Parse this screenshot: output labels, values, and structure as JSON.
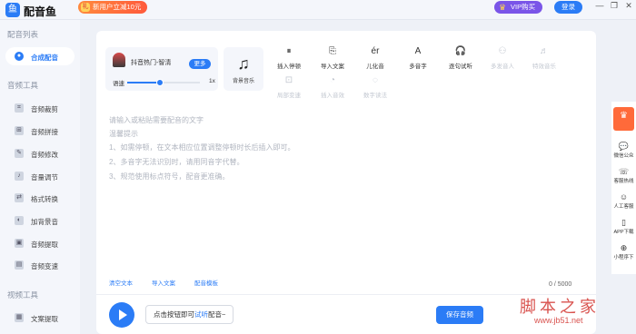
{
  "app": {
    "name": "配音鱼",
    "logo_glyph": "鱼"
  },
  "topbar": {
    "promo": "新用户立减10元",
    "gift_glyph": "礼",
    "vip": "VIP购买",
    "login": "登录",
    "controls": [
      "—",
      "❐",
      "✕"
    ]
  },
  "sidebar": {
    "sections": [
      {
        "title": "配音列表",
        "items": [
          {
            "label": "合成配音",
            "icon": "mic-icon",
            "glyph": "●",
            "active": true
          }
        ]
      },
      {
        "title": "音频工具",
        "items": [
          {
            "label": "音频裁剪",
            "icon": "crop-icon",
            "glyph": "⌗"
          },
          {
            "label": "音频拼接",
            "icon": "merge-icon",
            "glyph": "⊞"
          },
          {
            "label": "音频修改",
            "icon": "edit-icon",
            "glyph": "✎"
          },
          {
            "label": "音量调节",
            "icon": "volume-icon",
            "glyph": "♪"
          },
          {
            "label": "格式转换",
            "icon": "convert-icon",
            "glyph": "⇄"
          },
          {
            "label": "加背景音",
            "icon": "add-bg-icon",
            "glyph": "◐"
          },
          {
            "label": "音频提取",
            "icon": "extract-icon",
            "glyph": "▣"
          },
          {
            "label": "音频变速",
            "icon": "speed-icon",
            "glyph": "▤"
          }
        ]
      },
      {
        "title": "视频工具",
        "items": [
          {
            "label": "文案提取",
            "icon": "text-extract-icon",
            "glyph": "▦"
          }
        ]
      }
    ]
  },
  "voice": {
    "name": "抖音热门-智清",
    "more": "更多",
    "speed_label": "语速",
    "speed_value": "1x",
    "speed_fraction": 0.45
  },
  "bgmusic": {
    "label": "背景音乐",
    "glyph": "♫"
  },
  "tools": [
    {
      "label": "插入停顿",
      "icon": "pause-icon",
      "glyph": "⏸",
      "enabled": true
    },
    {
      "label": "导入文案",
      "icon": "import-text-icon",
      "glyph": "⎘",
      "enabled": true
    },
    {
      "label": "儿化音",
      "icon": "erhua-icon",
      "glyph": "ér",
      "enabled": true
    },
    {
      "label": "多音字",
      "icon": "polyphone-icon",
      "glyph": "A",
      "enabled": true
    },
    {
      "label": "逐句试听",
      "icon": "headphone-icon",
      "glyph": "🎧",
      "enabled": true
    },
    {
      "label": "多发音人",
      "icon": "multi-speaker-icon",
      "glyph": "⚇",
      "enabled": false
    },
    {
      "label": "特效音乐",
      "icon": "effect-music-icon",
      "glyph": "♬",
      "enabled": false
    },
    {
      "label": "局部变速",
      "icon": "local-speed-icon",
      "glyph": "⊡",
      "enabled": false
    },
    {
      "label": "插入音效",
      "icon": "sound-effect-icon",
      "glyph": "◔",
      "enabled": false
    },
    {
      "label": "数字读法",
      "icon": "number-read-icon",
      "glyph": "◌",
      "enabled": false
    }
  ],
  "editor": {
    "placeholder": "请输入或粘贴需要配音的文字",
    "tip_title": "温馨提示",
    "tips": [
      "1、如需停顿，在文本相应位置调整停顿时长后插入即可。",
      "2、多音字无法识别时，请用同音字代替。",
      "3、规范使用标点符号，配音更准确。"
    ],
    "counter": "0 / 5000"
  },
  "quick_actions": [
    "清空文本",
    "导入文案",
    "配音模板"
  ],
  "bottom": {
    "hint_prefix": "点击按钮即可",
    "hint_link": "试听",
    "hint_suffix": "配音~",
    "save": "保存音频"
  },
  "right_panel": {
    "top_glyph": "♛",
    "items": [
      {
        "label": "微信公众",
        "glyph": "💬"
      },
      {
        "label": "客服热线",
        "glyph": "☏"
      },
      {
        "label": "人工客服",
        "glyph": "☺"
      },
      {
        "label": "APP下载",
        "glyph": "▯"
      },
      {
        "label": "小程序下",
        "glyph": "⊕"
      }
    ]
  },
  "watermark": {
    "title": "脚本之家",
    "url": "www.jb51.net"
  }
}
